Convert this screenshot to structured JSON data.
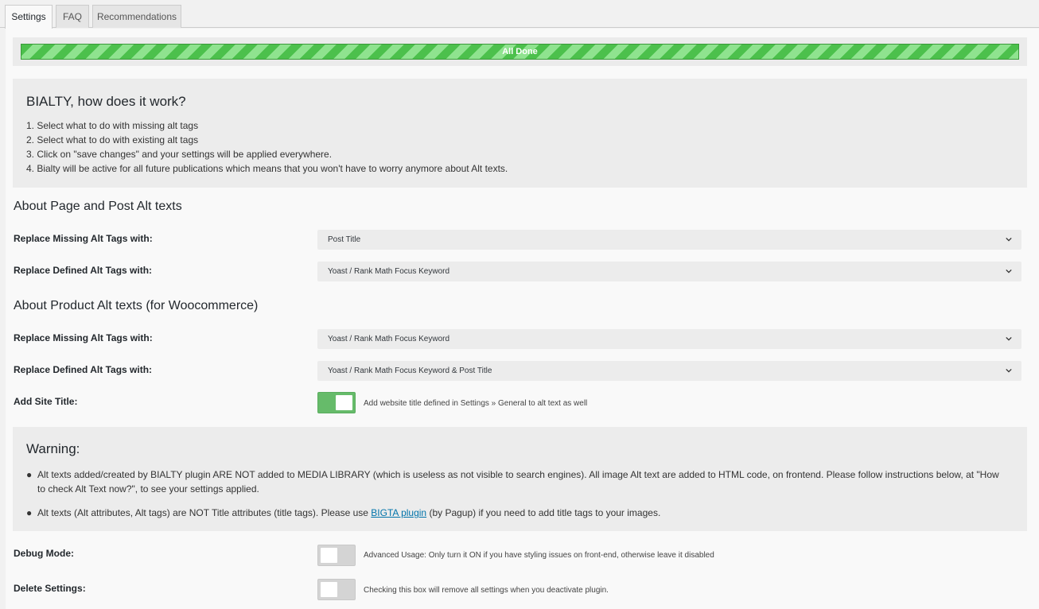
{
  "tabs": [
    {
      "label": "Settings",
      "active": true
    },
    {
      "label": "FAQ",
      "active": false
    },
    {
      "label": "Recommendations",
      "active": false
    }
  ],
  "progress": {
    "label": "All Done",
    "percent": 100
  },
  "how_it_works": {
    "title": "BIALTY, how does it work?",
    "steps": [
      "1. Select what to do with missing alt tags",
      "2. Select what to do with existing alt tags",
      "3. Click on \"save changes\" and your settings will be applied everywhere.",
      "4. Bialty will be active for all future publications which means that you won't have to worry anymore about Alt texts."
    ]
  },
  "page_post": {
    "title": "About Page and Post Alt texts",
    "missing_label": "Replace Missing Alt Tags with:",
    "missing_value": "Post Title",
    "defined_label": "Replace Defined Alt Tags with:",
    "defined_value": "Yoast / Rank Math Focus Keyword"
  },
  "product": {
    "title": "About Product Alt texts (for Woocommerce)",
    "missing_label": "Replace Missing Alt Tags with:",
    "missing_value": "Yoast / Rank Math Focus Keyword",
    "defined_label": "Replace Defined Alt Tags with:",
    "defined_value": "Yoast / Rank Math Focus Keyword & Post Title",
    "site_title_label": "Add Site Title:",
    "site_title_enabled": true,
    "site_title_desc": "Add website title defined in Settings » General to alt text as well"
  },
  "warning": {
    "title": "Warning:",
    "bullet": "●",
    "item1": "Alt texts added/created by BIALTY plugin ARE NOT added to MEDIA LIBRARY (which is useless as not visible to search engines). All image Alt text are added to HTML code, on frontend. Please follow instructions below, at \"How to check Alt Text now?\", to see your settings applied.",
    "item2_before": "Alt texts (Alt attributes, Alt tags) are NOT Title attributes (title tags). Please use ",
    "item2_link": "BIGTA plugin",
    "item2_after": " (by Pagup) if you need to add title tags to your images."
  },
  "debug": {
    "label": "Debug Mode:",
    "enabled": false,
    "desc": "Advanced Usage: Only turn it ON if you have styling issues on front-end, otherwise leave it disabled"
  },
  "delete_settings": {
    "label": "Delete Settings:",
    "enabled": false,
    "desc": "Checking this box will remove all settings when you deactivate plugin."
  },
  "colors": {
    "accent_green": "#66bb6a",
    "link": "#0073aa",
    "toggle_off": "#d4d4d4"
  },
  "icons": {
    "select_arrow": "chevron-down-icon"
  }
}
